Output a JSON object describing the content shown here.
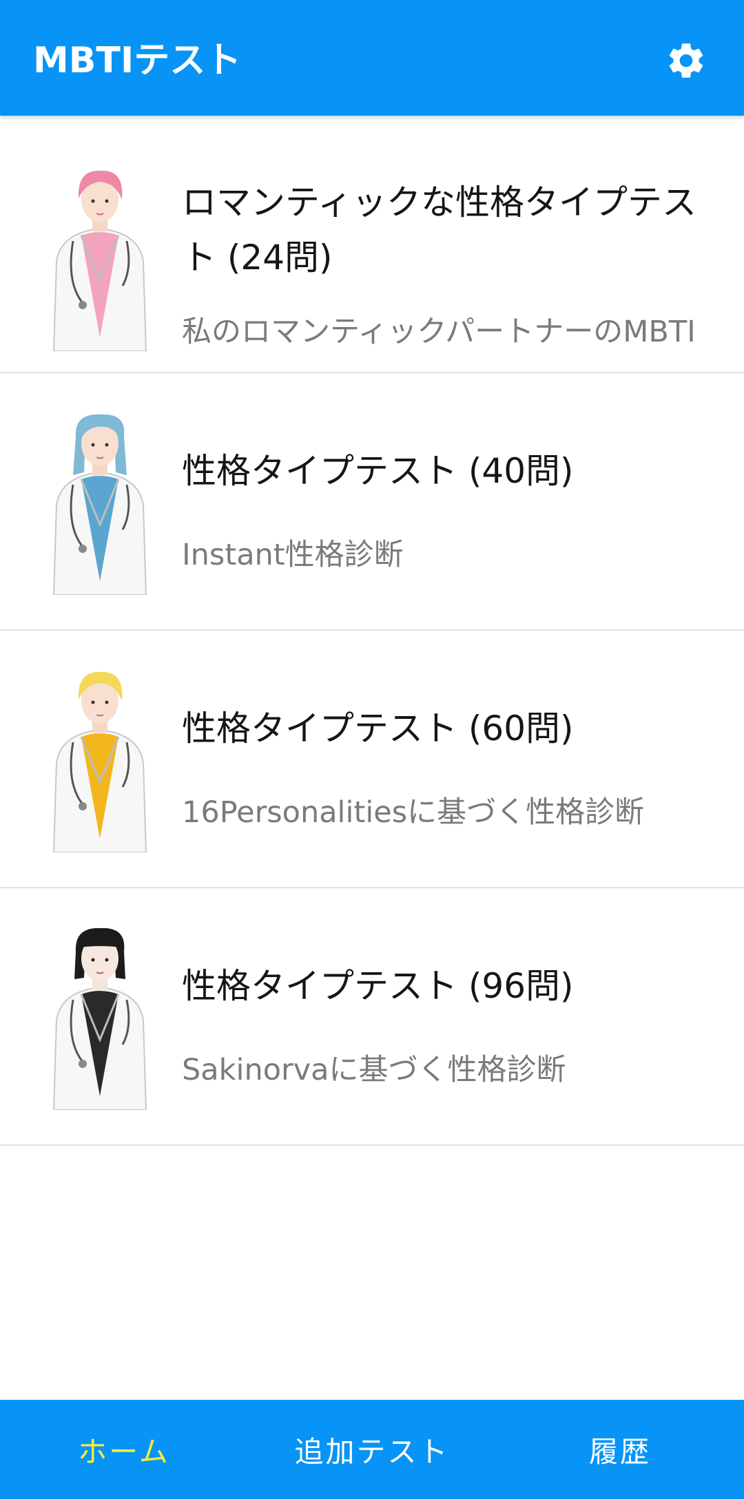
{
  "app_bar": {
    "title": "MBTIテスト",
    "settings_icon": "gear-icon"
  },
  "tests": [
    {
      "title": "ロマンティックな性格タイプテスト (24問)",
      "subtitle": "私のロマンティックパートナーのMBTI",
      "avatar": "doctor-pink-hair-avatar"
    },
    {
      "title": "性格タイプテスト (40問)",
      "subtitle": "Instant性格診断",
      "avatar": "doctor-blue-hair-avatar"
    },
    {
      "title": "性格タイプテスト (60問)",
      "subtitle": "16Personalitiesに基づく性格診断",
      "avatar": "doctor-blonde-hair-avatar"
    },
    {
      "title": "性格タイプテスト (96問)",
      "subtitle": "Sakinorvaに基づく性格診断",
      "avatar": "doctor-black-hair-avatar"
    }
  ],
  "bottom_nav": {
    "items": [
      {
        "label": "ホーム",
        "active": true
      },
      {
        "label": "追加テスト",
        "active": false
      },
      {
        "label": "履歴",
        "active": false
      }
    ]
  },
  "colors": {
    "primary": "#0794F6",
    "active_nav": "#FFEB3B",
    "title_text": "#151515",
    "subtitle_text": "#7a7a7a",
    "divider": "#e3e3e3"
  }
}
